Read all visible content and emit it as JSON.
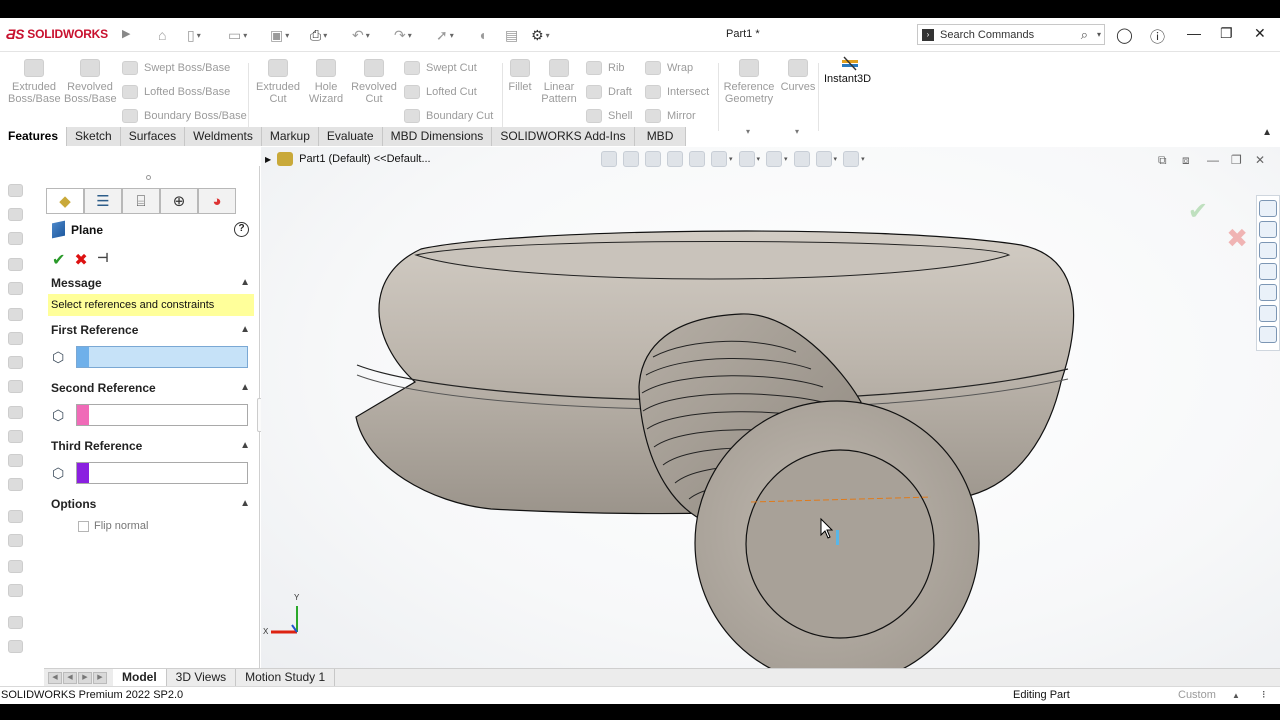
{
  "app": {
    "brand": "SOLIDWORKS",
    "document_title": "Part1 *",
    "search_placeholder": "Search Commands"
  },
  "ribbon": {
    "extruded_boss": "Extruded\nBoss/Base",
    "revolved_boss": "Revolved\nBoss/Base",
    "swept_boss": "Swept Boss/Base",
    "lofted_boss": "Lofted Boss/Base",
    "boundary_boss": "Boundary Boss/Base",
    "extruded_cut": "Extruded\nCut",
    "hole_wizard": "Hole\nWizard",
    "revolved_cut": "Revolved\nCut",
    "swept_cut": "Swept Cut",
    "lofted_cut": "Lofted Cut",
    "boundary_cut": "Boundary Cut",
    "fillet": "Fillet",
    "linear_pattern": "Linear\nPattern",
    "rib": "Rib",
    "draft": "Draft",
    "shell": "Shell",
    "wrap": "Wrap",
    "intersect": "Intersect",
    "mirror": "Mirror",
    "reference_geometry": "Reference\nGeometry",
    "curves": "Curves",
    "instant3d": "Instant3D"
  },
  "tabs": [
    "Features",
    "Sketch",
    "Surfaces",
    "Weldments",
    "Markup",
    "Evaluate",
    "MBD Dimensions",
    "SOLIDWORKS Add-Ins",
    "MBD"
  ],
  "property_manager": {
    "title": "Plane",
    "message_header": "Message",
    "message": "Select references and constraints",
    "first_reference": "First Reference",
    "second_reference": "Second Reference",
    "third_reference": "Third Reference",
    "options_header": "Options",
    "flip_normal": "Flip normal",
    "ref_colors": [
      "#6fb0ea",
      "#f06bb8",
      "#8a1fe0"
    ]
  },
  "graphics": {
    "tree_label": "Part1 (Default) <<Default...",
    "triad_y": "Y",
    "triad_x": "X"
  },
  "bottom_tabs": [
    "Model",
    "3D Views",
    "Motion Study 1"
  ],
  "status": {
    "product": "SOLIDWORKS Premium 2022 SP2.0",
    "mode": "Editing Part",
    "units": "Custom"
  }
}
